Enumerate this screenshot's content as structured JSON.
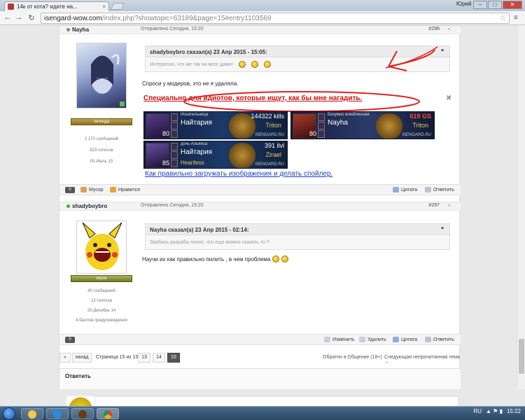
{
  "browser": {
    "tab_title": "14к от кота? идите на...",
    "tab_close": "×",
    "user": "Юрий",
    "url_host": "isengard-wow.com",
    "url_path": "/index.php?showtopic=63189&page=15#entry1103569",
    "back_icon": "arrow-left",
    "forward_icon": "arrow-right",
    "reload_icon": "reload",
    "star_icon": "star"
  },
  "post1": {
    "author": "Nayha",
    "status_color": "#8a8a8a",
    "posted": "Отправлено Сегодня, 15:20",
    "number": "#296",
    "rank": "легенда",
    "stats": [
      "2 170 сообщений",
      "823 голосов",
      "05-Июль 10"
    ],
    "quote_header": "shadyboybro сказал(а) 23 Апр 2015 - 15:05:",
    "quote_text": "Интересно, что же так на мозг давит",
    "reply_text": "Спроси у модеров, это не я удаляла.",
    "sig_heading": "Специально для идиотов, которые ищут, как бы мне нагадить.",
    "sig_cards": [
      {
        "caption": "Искательница",
        "level": "80",
        "name": "Найтария",
        "sub": "",
        "value": "144322 kills",
        "realm": "Triton",
        "site": "ISENGARD.RU",
        "red": false
      },
      {
        "caption": "Безумно влюбленная",
        "level": "80",
        "name": "Nayha",
        "sub": "",
        "value": "619 GS",
        "realm": "Triton",
        "site": "ISENGARD.RU",
        "red": true
      },
      {
        "caption": "дочь Альянса",
        "level": "85",
        "name": "Найтария",
        "sub": "Heartless",
        "value": "391 ilvl",
        "realm": "Zirael",
        "site": "ISENGARD.RU",
        "red": false
      }
    ],
    "help_link": "Как правильно загружать изображения и делать спойлер.",
    "actions": {
      "count": "0",
      "trash": "Мусор",
      "like": "Нравится",
      "quote": "Цитата",
      "answer": "Ответить"
    }
  },
  "post2": {
    "author": "shadyboybro",
    "status_color": "#3fae3a",
    "posted": "Отправлено Сегодня, 15:20",
    "number": "#297",
    "rank": "игрок",
    "stats": [
      "40 сообщений",
      "13 голосов",
      "25-Декабрь 14",
      "4 баллов предупреждения"
    ],
    "quote_header": "Nayha сказал(а) 23 Апр 2015 - 02:14:",
    "quote_text": "Заебись разрабы пилят, что еще можно сказать то ?",
    "reply_text": "Научи их как правильно пилить , в чем проблема",
    "actions": {
      "count": "0",
      "edit": "Изменить",
      "delete": "Удалить",
      "quote": "Цитата",
      "answer": "Ответить"
    }
  },
  "pager": {
    "first": "«",
    "prev": "назад",
    "label": "Страница 15 из 15",
    "pages": [
      "13",
      "14",
      "15"
    ],
    "current": "15",
    "back_link": "Обратно в Общение (18+)",
    "next_link": "Следующая непрочитанная тема →"
  },
  "reply_title": "Ответить",
  "taskbar": {
    "lang": "RU",
    "time": "15:22"
  },
  "colors": {
    "accent_red": "#cc1111",
    "link_blue": "#1b3fbf",
    "rank_gold": "#bfa349"
  }
}
